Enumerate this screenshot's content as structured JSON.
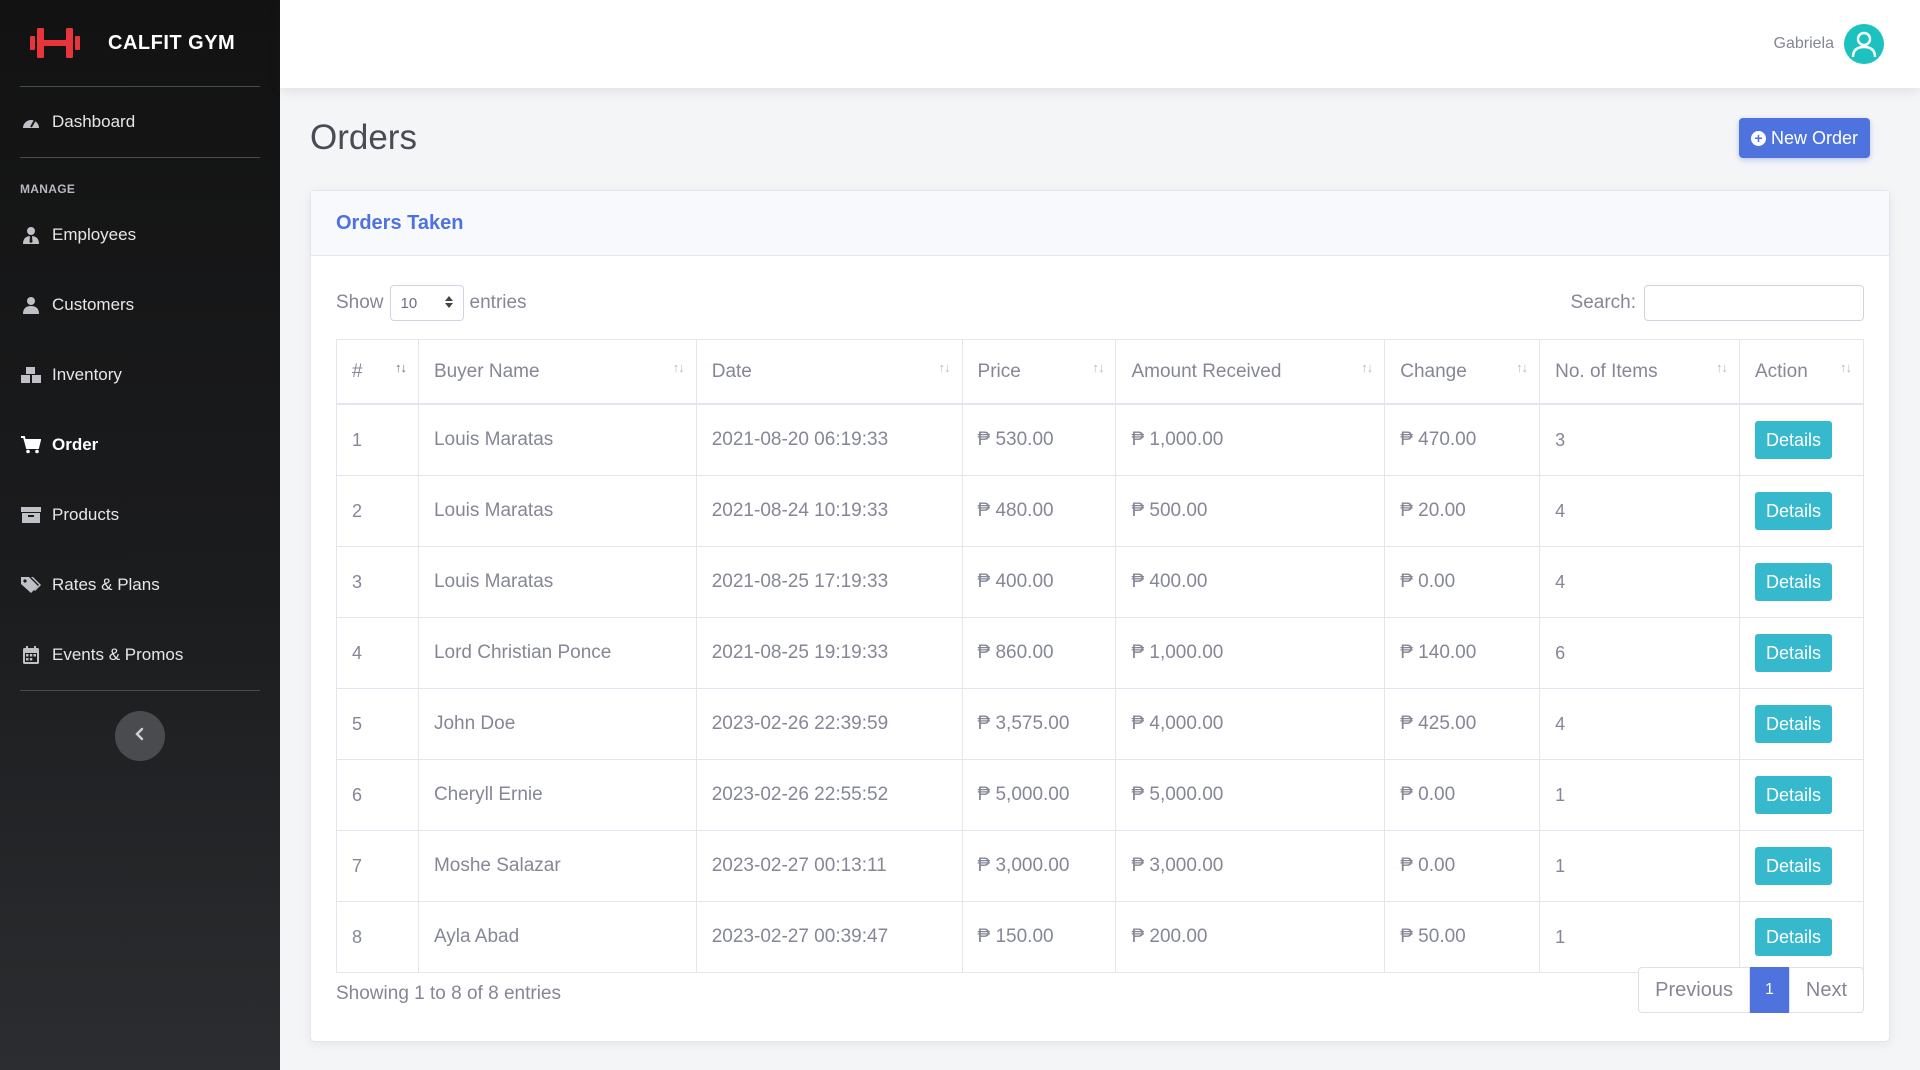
{
  "brand": {
    "name": "CALFIT GYM",
    "logo_color": "#e8353b"
  },
  "sidebar": {
    "dashboard": {
      "label": "Dashboard",
      "icon": "tachometer-icon"
    },
    "section_heading": "MANAGE",
    "items": [
      {
        "label": "Employees",
        "icon": "user-tie-icon"
      },
      {
        "label": "Customers",
        "icon": "user-icon"
      },
      {
        "label": "Inventory",
        "icon": "boxes-icon"
      },
      {
        "label": "Order",
        "icon": "cart-icon",
        "active": true
      },
      {
        "label": "Products",
        "icon": "box-icon"
      },
      {
        "label": "Rates & Plans",
        "icon": "tags-icon"
      },
      {
        "label": "Events & Promos",
        "icon": "calendar-icon"
      }
    ]
  },
  "topbar": {
    "user_name": "Gabriela",
    "avatar_color": "#1bc2c0"
  },
  "page": {
    "title": "Orders",
    "new_order_label": "New Order"
  },
  "card": {
    "title": "Orders Taken"
  },
  "table_controls": {
    "show_label": "Show",
    "entries_value": "10",
    "entries_label": "entries",
    "search_label": "Search:"
  },
  "table": {
    "columns": [
      "#",
      "Buyer Name",
      "Date",
      "Price",
      "Amount Received",
      "Change",
      "No. of Items",
      "Action"
    ],
    "rows": [
      [
        "1",
        "Louis Maratas",
        "2021-08-20 06:19:33",
        "₱ 530.00",
        "₱ 1,000.00",
        "₱ 470.00",
        "3",
        "Details"
      ],
      [
        "2",
        "Louis Maratas",
        "2021-08-24 10:19:33",
        "₱ 480.00",
        "₱ 500.00",
        "₱ 20.00",
        "4",
        "Details"
      ],
      [
        "3",
        "Louis Maratas",
        "2021-08-25 17:19:33",
        "₱ 400.00",
        "₱ 400.00",
        "₱ 0.00",
        "4",
        "Details"
      ],
      [
        "4",
        "Lord Christian Ponce",
        "2021-08-25 19:19:33",
        "₱ 860.00",
        "₱ 1,000.00",
        "₱ 140.00",
        "6",
        "Details"
      ],
      [
        "5",
        "John Doe",
        "2023-02-26 22:39:59",
        "₱ 3,575.00",
        "₱ 4,000.00",
        "₱ 425.00",
        "4",
        "Details"
      ],
      [
        "6",
        "Cheryll Ernie",
        "2023-02-26 22:55:52",
        "₱ 5,000.00",
        "₱ 5,000.00",
        "₱ 0.00",
        "1",
        "Details"
      ],
      [
        "7",
        "Moshe Salazar",
        "2023-02-27 00:13:11",
        "₱ 3,000.00",
        "₱ 3,000.00",
        "₱ 0.00",
        "1",
        "Details"
      ],
      [
        "8",
        "Ayla Abad",
        "2023-02-27 00:39:47",
        "₱ 150.00",
        "₱ 200.00",
        "₱ 50.00",
        "1",
        "Details"
      ]
    ]
  },
  "footer": {
    "info": "Showing 1 to 8 of 8 entries",
    "previous": "Previous",
    "page": "1",
    "next": "Next"
  },
  "colors": {
    "primary": "#4e73df",
    "info": "#36b9cc"
  }
}
